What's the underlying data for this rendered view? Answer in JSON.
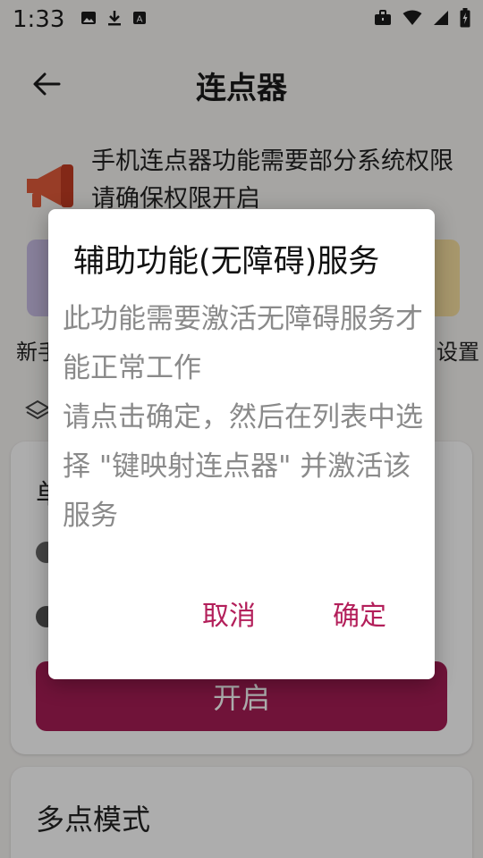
{
  "status_bar": {
    "time": "1:33",
    "icons": [
      "image-icon",
      "download-icon",
      "a-icon",
      "work-icon",
      "wifi-icon",
      "signal-icon",
      "battery-charging-icon"
    ]
  },
  "appbar": {
    "title": "连点器",
    "back_icon": "arrow-left-icon"
  },
  "notice": {
    "icon": "megaphone-icon",
    "text": "手机连点器功能需要部分系统权限请确保权限开启"
  },
  "shortcuts": {
    "left_label": "新手",
    "right_label": "设置"
  },
  "card1": {
    "title": "单",
    "button_label": "开启"
  },
  "card2": {
    "title": "多点模式"
  },
  "dialog": {
    "title": "辅助功能(无障碍)服务",
    "body_lines": [
      "此功能需要激活无障碍服务才能正常工作",
      "请点击确定，然后在列表中选择 \"键映射连点器\" 并激活该服务"
    ],
    "cancel_label": "取消",
    "ok_label": "确定",
    "accent_color": "#b31f5a"
  }
}
